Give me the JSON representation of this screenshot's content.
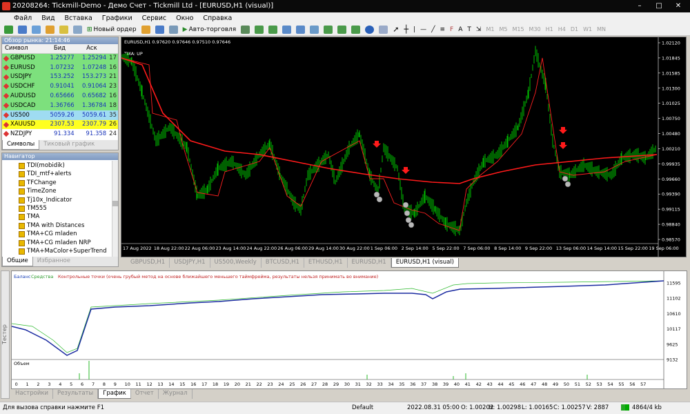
{
  "window": {
    "title": "20208264: Tickmill-Demo - Демо Счет - Tickmill Ltd - [EURUSD,H1 (visual)]"
  },
  "menu": [
    "Файл",
    "Вид",
    "Вставка",
    "Графики",
    "Сервис",
    "Окно",
    "Справка"
  ],
  "toolbar": {
    "new_order": "Новый ордер",
    "autotrade": "Авто-торговля",
    "timeframes": [
      "M1",
      "M5",
      "M15",
      "M30",
      "H1",
      "H4",
      "D1",
      "W1",
      "MN"
    ]
  },
  "market_watch": {
    "title": "Обзор рынка: 21:14:46",
    "headers": {
      "symbol": "Символ",
      "bid": "Бид",
      "ask": "Аск"
    },
    "rows": [
      {
        "symbol": "GBPUSD",
        "bid": "1.25277",
        "ask": "1.25294",
        "spread": "17",
        "bg": "#7de07d"
      },
      {
        "symbol": "EURUSD",
        "bid": "1.07232",
        "ask": "1.07248",
        "spread": "16",
        "bg": "#7de07d"
      },
      {
        "symbol": "USDJPY",
        "bid": "153.252",
        "ask": "153.273",
        "spread": "21",
        "bg": "#7de07d"
      },
      {
        "symbol": "USDCHF",
        "bid": "0.91041",
        "ask": "0.91064",
        "spread": "23",
        "bg": "#7de07d"
      },
      {
        "symbol": "AUDUSD",
        "bid": "0.65666",
        "ask": "0.65682",
        "spread": "16",
        "bg": "#7de07d"
      },
      {
        "symbol": "USDCAD",
        "bid": "1.36766",
        "ask": "1.36784",
        "spread": "18",
        "bg": "#7de07d"
      },
      {
        "symbol": "US500",
        "bid": "5059.26",
        "ask": "5059.61",
        "spread": "35",
        "bg": "#9fdcf2"
      },
      {
        "symbol": "XAUUSD",
        "bid": "2307.53",
        "ask": "2307.79",
        "spread": "26",
        "bg": "#ffff20"
      },
      {
        "symbol": "NZDJPY",
        "bid": "91.334",
        "ask": "91.358",
        "spread": "24",
        "bg": "#ffffff"
      }
    ],
    "tabs": [
      "Символы",
      "Тиковый график"
    ]
  },
  "navigator": {
    "title": "Навигатор",
    "items": [
      "TDI(mobidik)",
      "TDI_mtf+alerts",
      "TFChange",
      "TimeZone",
      "Tj10x_Indicator",
      "TM555",
      "TMA",
      "TMA with Distances",
      "TMA+CG mladen",
      "TMA+CG mladen NRP",
      "TMA+MaColor+SuperTrend"
    ],
    "tabs": [
      "Общие",
      "Избранное"
    ]
  },
  "chart": {
    "header": "EURUSD,H1  0.97620 0.97646 0.97510 0.97646",
    "indicator_label": "TMA: UP",
    "price_labels": [
      "1.02120",
      "1.01845",
      "1.01585",
      "1.01300",
      "1.01025",
      "1.00750",
      "1.00480",
      "1.00210",
      "0.99935",
      "0.99660",
      "0.99390",
      "0.99115",
      "0.98840",
      "0.98570"
    ],
    "time_labels": [
      "17 Aug 2022",
      "18 Aug 22:00",
      "22 Aug 06:00",
      "23 Aug 14:00",
      "24 Aug 22:00",
      "26 Aug 06:00",
      "29 Aug 14:00",
      "30 Aug 22:00",
      "1 Sep 06:00",
      "2 Sep 14:00",
      "5 Sep 22:00",
      "7 Sep 06:00",
      "8 Sep 14:00",
      "9 Sep 22:00",
      "13 Sep 06:00",
      "14 Sep 14:00",
      "15 Sep 22:00",
      "19 Sep 06:00"
    ],
    "colors": {
      "candles": "#00c000",
      "tma": "#ff1a1a",
      "ma": "#7cfc00",
      "axis": "#ffffff"
    }
  },
  "chart_tabs": [
    "GBPUSD,H1",
    "USDJPY,H1",
    "US500,Weekly",
    "BTCUSD,H1",
    "ETHUSD,H1",
    "EURUSD,H1",
    "EURUSD,H1 (visual)"
  ],
  "tester": {
    "legend": {
      "balance": "Баланс",
      "equity": "Средства",
      "checkpoints": "Контрольные точки (очень грубый метод на основе ближайшего меньшего таймфрейма, результаты нельзя принимать во внимание)"
    },
    "y_labels": [
      "11595",
      "11102",
      "10610",
      "10117",
      "9625",
      "9132"
    ],
    "volume_label": "Объем",
    "x_labels": [
      "0",
      "1",
      "2",
      "3",
      "4",
      "5",
      "6",
      "7",
      "8",
      "9",
      "10",
      "11",
      "12",
      "13",
      "14",
      "15",
      "16",
      "17",
      "18",
      "19",
      "20",
      "21",
      "22",
      "23",
      "24",
      "25",
      "26",
      "27",
      "28",
      "29",
      "30",
      "31",
      "32",
      "33",
      "34",
      "35",
      "36",
      "37",
      "38",
      "39",
      "40",
      "41",
      "42",
      "43",
      "44",
      "45",
      "46",
      "47",
      "48",
      "49",
      "50",
      "51",
      "52",
      "53",
      "54",
      "55",
      "56",
      "57"
    ],
    "tabs": [
      "Настройки",
      "Результаты",
      "График",
      "Отчет",
      "Журнал"
    ],
    "side_label": "Тестер"
  },
  "status": {
    "help": "Для вызова справки нажмите F1",
    "profile": "Default",
    "time": "2022.08.31 05:00",
    "open": "O: 1.00202",
    "high": "H: 1.00298",
    "low": "L: 1.00165",
    "close": "C: 1.00257",
    "volume": "V: 2887",
    "traffic": "4864/4 kb"
  }
}
